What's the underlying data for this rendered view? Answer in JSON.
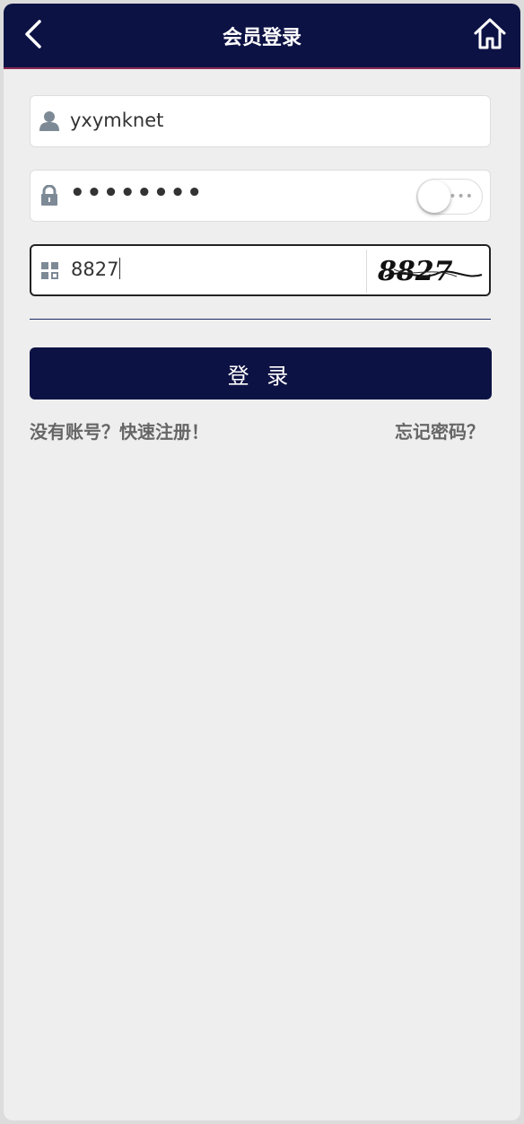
{
  "header": {
    "title": "会员登录"
  },
  "form": {
    "username_value": "yxymknet",
    "password_mask": "••••••••",
    "captcha_value": "8827",
    "captcha_image_text": "8827",
    "login_label": "登 录"
  },
  "links": {
    "register": "没有账号？快速注册！",
    "forgot": "忘记密码？"
  },
  "colors": {
    "header_bg": "#0d1244",
    "button_bg": "#0d1244",
    "page_bg": "#eeeeee"
  },
  "icons": {
    "back": "chevron-left-icon",
    "home": "home-icon",
    "user": "user-icon",
    "lock": "lock-icon",
    "captcha": "grid-icon"
  }
}
